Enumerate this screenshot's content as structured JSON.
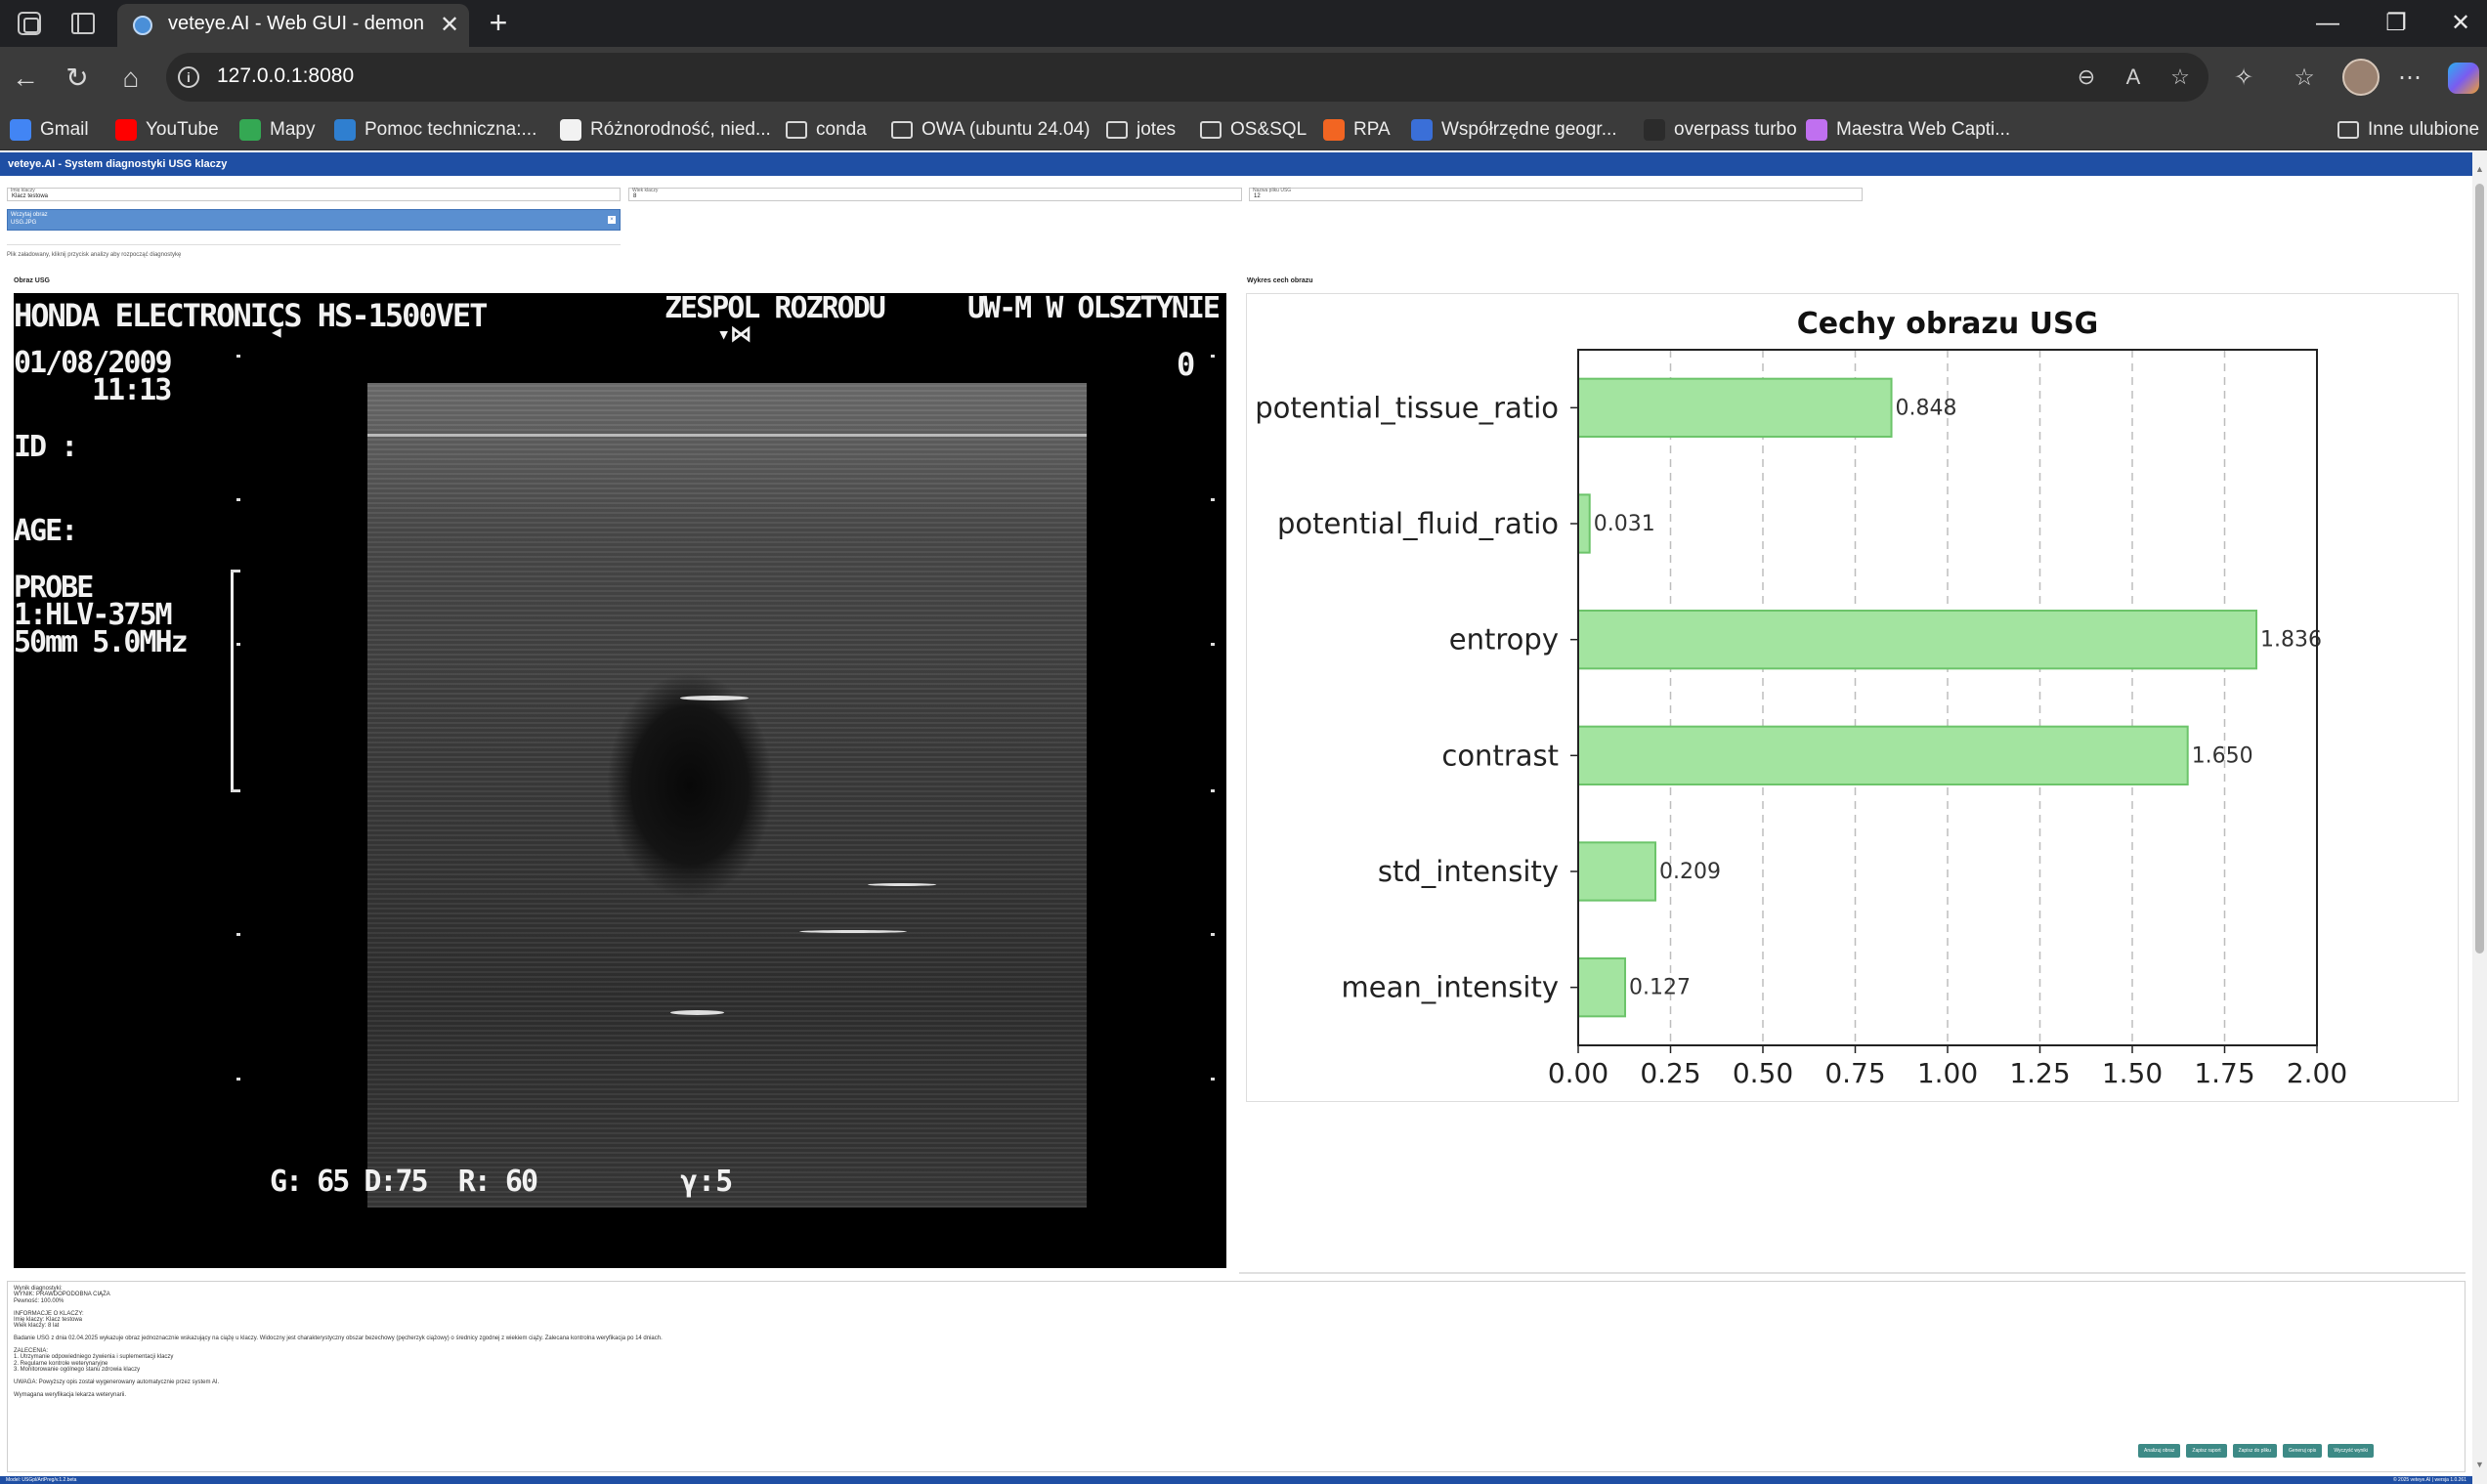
{
  "browser": {
    "tab_title": "veteye.AI - Web GUI - demonstrat",
    "url": "127.0.0.1:8080",
    "bookmarks": [
      {
        "label": "Gmail",
        "icon": "google-icon",
        "color": "#4285f4"
      },
      {
        "label": "YouTube",
        "icon": "youtube-icon",
        "color": "#ff0000"
      },
      {
        "label": "Mapy",
        "icon": "maps-icon",
        "color": "#34a853"
      },
      {
        "label": "Pomoc techniczna:...",
        "icon": "dell-icon",
        "color": "#2f7fd0"
      },
      {
        "label": "Różnorodność, nied...",
        "icon": "ai-icon",
        "color": "#f2f2f2"
      },
      {
        "label": "conda",
        "icon": "folder-icon",
        "color": "folder"
      },
      {
        "label": "OWA (ubuntu 24.04)",
        "icon": "folder-icon",
        "color": "folder"
      },
      {
        "label": "jotes",
        "icon": "folder-icon",
        "color": "folder"
      },
      {
        "label": "OS&SQL",
        "icon": "folder-icon",
        "color": "folder"
      },
      {
        "label": "RPA",
        "icon": "uipath-icon",
        "color": "#f26522"
      },
      {
        "label": "Współrzędne geogr...",
        "icon": "gps-icon",
        "color": "#3a6fd8"
      },
      {
        "label": "overpass turbo",
        "icon": "overpass-icon",
        "color": "#2b2b2b"
      },
      {
        "label": "Maestra Web Capti...",
        "icon": "maestra-icon",
        "color": "#c070f0"
      }
    ],
    "favorites_label": "Inne ulubione"
  },
  "app": {
    "header_title": "veteye.AI - System diagnostyki USG klaczy",
    "fields": [
      {
        "label": "Imię klaczy",
        "value": "Klacz testowa"
      },
      {
        "label": "Wiek klaczy",
        "value": "8"
      },
      {
        "label": "Nazwa pliku USG",
        "value": "12"
      }
    ],
    "upload": {
      "line1": "Wczytaj obraz",
      "line2": "USG.JPG"
    },
    "status": "Plik załadowany, kliknij przycisk analizy aby rozpocząć diagnostykę",
    "usg_panel_title": "Obraz USG",
    "chart_panel_title": "Wykres cech obrazu",
    "usg_overlay": {
      "device": "HONDA ELECTRONICS HS-1500VET",
      "team": "ZESPOL ROZRODU",
      "institution": "UW-M W OLSZTYNIE",
      "date": "01/08/2009",
      "time": "11:13",
      "id_label": "ID :",
      "age_label": "AGE:",
      "probe": "PROBE",
      "probe_model": "1:HLV-375M",
      "probe_spec": "50mm 5.0MHz",
      "depth_marker": "0",
      "params": "G: 65 D:75  R: 60",
      "gamma": "γ:5"
    },
    "report_lines": [
      "Wynik diagnostyki:",
      "WYNIK: PRAWDOPODOBNA CIĄŻA",
      "Pewność: 100.00%",
      "",
      "INFORMACJE O KLACZY:",
      "Imię klaczy: Klacz testowa",
      "Wiek klaczy: 8 lat",
      "",
      "Badanie USG z dnia 02.04.2025 wykazuje obraz jednoznacznie wskazujący na ciążę u klaczy. Widoczny jest charakterystyczny obszar bezechowy (pęcherzyk ciążowy) o średnicy zgodnej z wiekiem ciąży. Zalecana kontrolna weryfikacja po 14 dniach.",
      "",
      "ZALECENIA:",
      "1. Utrzymanie odpowiedniego żywienia i suplementacji klaczy",
      "2. Regularne kontrole weterynaryjne",
      "3. Monitorowanie ogólnego stanu zdrowia klaczy",
      "",
      "UWAGA: Powyższy opis został wygenerowany automatycznie przez system AI.",
      "",
      "Wymagana weryfikacja lekarza weterynarii."
    ],
    "actions": [
      "Analizuj obraz",
      "Zapisz raport",
      "Zapisz do pliku",
      "Generuj opis",
      "Wyczyść wyniki"
    ],
    "footer_left": "Model: USGpl/ArtPreg/v.1.2.beta",
    "footer_right": "© 2025 veteye.AI | wersja 1.0.261"
  },
  "chart_data": {
    "type": "bar",
    "orientation": "horizontal",
    "title": "Cechy obrazu USG",
    "categories": [
      "potential_tissue_ratio",
      "potential_fluid_ratio",
      "entropy",
      "contrast",
      "std_intensity",
      "mean_intensity"
    ],
    "values": [
      0.848,
      0.031,
      1.836,
      1.65,
      0.209,
      0.127
    ],
    "value_labels": [
      "0.848",
      "0.031",
      "1.836",
      "1.650",
      "0.209",
      "0.127"
    ],
    "xlabel": "",
    "ylabel": "",
    "xlim": [
      0,
      2.0
    ],
    "xticks": [
      "0.00",
      "0.25",
      "0.50",
      "0.75",
      "1.00",
      "1.25",
      "1.50",
      "1.75",
      "2.00"
    ],
    "grid": "x-dashed",
    "bar_color": "#a3e4a0",
    "bar_edge": "#6cc46a"
  }
}
